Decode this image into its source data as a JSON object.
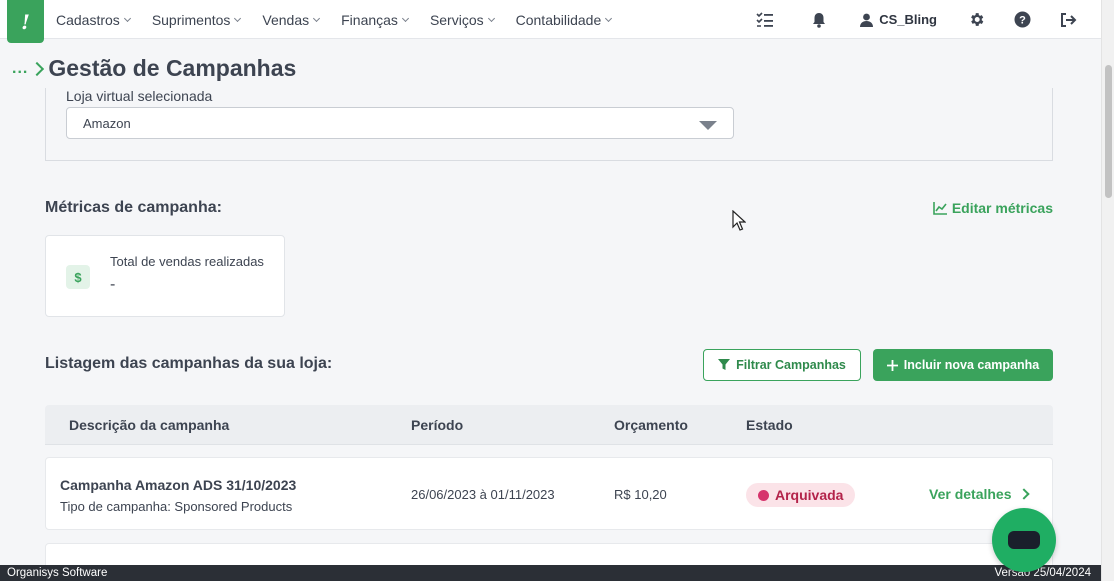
{
  "nav": {
    "logo": "!",
    "menu": [
      "Cadastros",
      "Suprimentos",
      "Vendas",
      "Finanças",
      "Serviços",
      "Contabilidade"
    ],
    "user": "CS_Bling"
  },
  "breadcrumb": {
    "ellipsis": "..."
  },
  "page": {
    "title": "Gestão de Campanhas"
  },
  "store": {
    "label": "Loja virtual selecionada",
    "selected": "Amazon"
  },
  "metrics": {
    "title": "Métricas de campanha:",
    "edit_label": "Editar métricas",
    "card": {
      "icon": "$",
      "label": "Total de vendas realizadas",
      "value": "-"
    }
  },
  "list": {
    "title": "Listagem das campanhas da sua loja:",
    "filter_label": "Filtrar Campanhas",
    "add_label": "Incluir nova campanha",
    "columns": [
      "Descrição da campanha",
      "Período",
      "Orçamento",
      "Estado"
    ],
    "rows": [
      {
        "name": "Campanha Amazon ADS 31/10/2023",
        "type": "Tipo de campanha: Sponsored Products",
        "period": "26/06/2023 à 01/11/2023",
        "budget": "R$ 10,20",
        "status": "Arquivada",
        "action": "Ver detalhes"
      }
    ]
  },
  "footer": {
    "left": "Organisys Software",
    "right": "Versão 25/04/2024"
  },
  "colors": {
    "brand": "#3aa35c",
    "status_archived": "#d6336c",
    "chat": "#1fae63"
  }
}
